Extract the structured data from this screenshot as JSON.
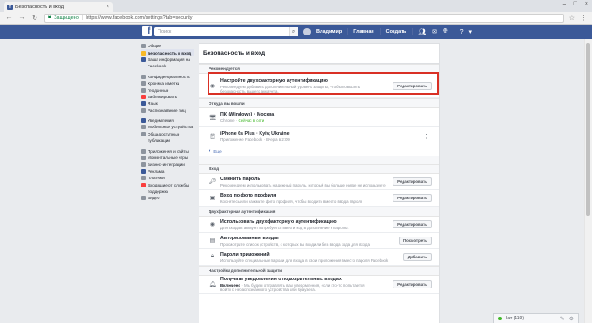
{
  "browser": {
    "tab_title": "Безопасность и вход",
    "secure_label": "Защищено",
    "url": "https://www.facebook.com/settings?tab=security"
  },
  "fbbar": {
    "logo": "f",
    "search_placeholder": "Поиск",
    "user_name": "Владимир",
    "home": "Главная",
    "create": "Создать"
  },
  "leftnav": {
    "groups": [
      [
        {
          "label": "Общие",
          "icon": "gear-icon",
          "color": "#8d949e"
        },
        {
          "label": "Безопасность и вход",
          "icon": "shield-icon",
          "color": "#f7b928",
          "active": true
        },
        {
          "label": "Ваша информация на",
          "icon": "facebook-icon",
          "color": "#3b5998"
        },
        {
          "label": "Facebook",
          "icon": "",
          "color": "transparent"
        }
      ],
      [
        {
          "label": "Конфиденциальность",
          "icon": "lock-icon",
          "color": "#8d949e"
        },
        {
          "label": "Хроника и метки",
          "icon": "timeline-icon",
          "color": "#8d949e"
        },
        {
          "label": "Геоданные",
          "icon": "location-icon",
          "color": "#8d949e"
        },
        {
          "label": "Заблокировать",
          "icon": "block-icon",
          "color": "#fa3e3e"
        },
        {
          "label": "Язык",
          "icon": "language-icon",
          "color": "#3b5998"
        },
        {
          "label": "Распознавание лиц",
          "icon": "face-icon",
          "color": "#8d949e"
        }
      ],
      [
        {
          "label": "Уведомления",
          "icon": "globe-icon",
          "color": "#3b5998"
        },
        {
          "label": "Мобильные устройства",
          "icon": "mobile-icon",
          "color": "#8d949e"
        },
        {
          "label": "Общедоступные",
          "icon": "rss-icon",
          "color": "#8d949e"
        },
        {
          "label": "публикации",
          "icon": "",
          "color": "transparent"
        }
      ],
      [
        {
          "label": "Приложения и сайты",
          "icon": "apps-icon",
          "color": "#8d949e"
        },
        {
          "label": "Моментальные игры",
          "icon": "games-icon",
          "color": "#8d949e"
        },
        {
          "label": "Бизнес-интеграции",
          "icon": "business-icon",
          "color": "#8d949e"
        },
        {
          "label": "Реклама",
          "icon": "ads-icon",
          "color": "#3b5998"
        },
        {
          "label": "Платежи",
          "icon": "payments-icon",
          "color": "#8d949e"
        },
        {
          "label": "Входящие от службы",
          "icon": "support-icon",
          "color": "#fa3e3e"
        },
        {
          "label": "поддержки",
          "icon": "",
          "color": "transparent"
        },
        {
          "label": "Видео",
          "icon": "video-icon",
          "color": "#8d949e"
        }
      ]
    ]
  },
  "main": {
    "title": "Безопасность и вход",
    "recommended": {
      "header": "Рекомендуется",
      "title": "Настройте двухфакторную аутентификацию",
      "desc": "Рекомендуем добавить дополнительный уровень защиты, чтобы повысить безопасность вашего аккаунта.",
      "button": "Редактировать"
    },
    "where_logged": {
      "header": "Откуда вы вошли",
      "sessions": [
        {
          "device": "ПК (Windows) · Москва",
          "meta1": "Chrome · ",
          "meta2": "Сейчас в сети"
        },
        {
          "device": "iPhone 6s Plus · Kyiv, Ukraine",
          "meta1": "Приложение Facebook · Вчера в 2:09",
          "meta2": ""
        }
      ],
      "more": "Еще"
    },
    "login": {
      "header": "Вход",
      "rows": [
        {
          "title": "Сменить пароль",
          "desc": "Рекомендуем использовать надежный пароль, который вы больше нигде не используете",
          "button": "Редактировать"
        },
        {
          "title": "Вход по фото профиля",
          "desc": "Коснитесь или нажмите фото профиля, чтобы входить вместо ввода пароля",
          "button": "Редактировать"
        }
      ]
    },
    "twofactor": {
      "header": "Двухфакторная аутентификация",
      "rows": [
        {
          "title": "Использовать двухфакторную аутентификацию",
          "desc": "Для входа в аккаунт потребуется ввести код в дополнение к паролю.",
          "button": "Редактировать"
        },
        {
          "title": "Авторизованные входы",
          "desc": "Просмотрите список устройств, с которых вы входили без ввода кода для входа",
          "button": "Посмотреть"
        },
        {
          "title": "Пароли приложений",
          "desc": "Используйте специальные пароли для входа в свои приложения вместо пароля Facebook",
          "button": "Добавить"
        }
      ]
    },
    "extra": {
      "header": "Настройка дополнительной защиты",
      "rows": [
        {
          "title": "Получать уведомления о подозрительных входах",
          "desc_on": "Включено",
          "desc": " · Мы будем отправлять вам уведомления, если кто-то попытается войти с нераспознанного устройства или браузера.",
          "button": "Редактировать"
        }
      ]
    }
  },
  "chat": {
    "label": "Чат (119)"
  }
}
